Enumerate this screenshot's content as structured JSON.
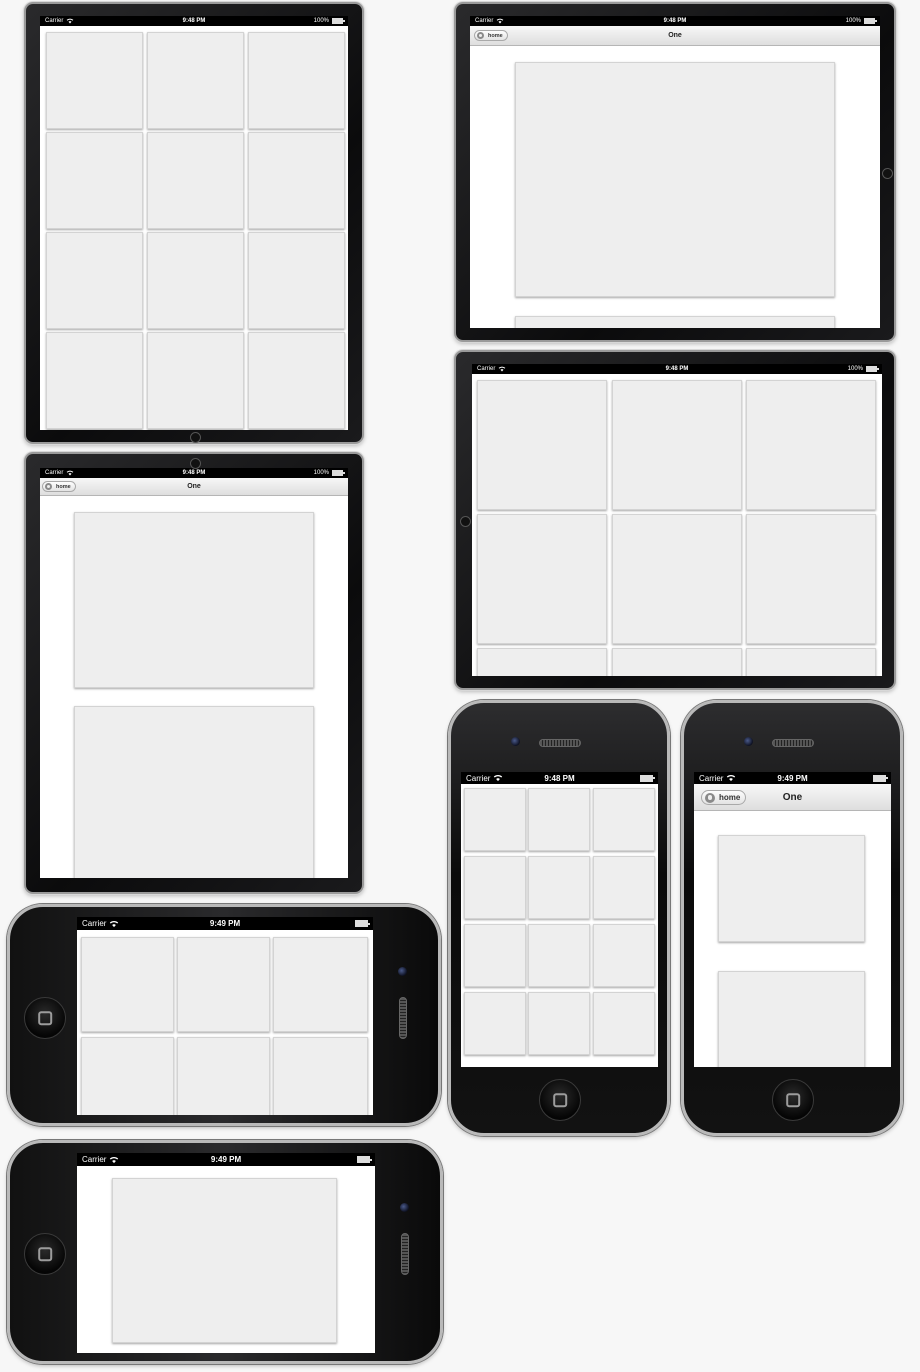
{
  "status": {
    "carrier": "Carrier",
    "battery": "100%",
    "time_948": "9:48 PM",
    "time_949": "9:49 PM"
  },
  "nav": {
    "back_label": "home",
    "title": "One"
  },
  "colors": {
    "device_body": "#0b0b0c",
    "screen_bg": "#ffffff",
    "tile_bg": "#eeeeee",
    "tile_border": "#d3d3d3",
    "navbar_top": "#f7f7f7",
    "navbar_bottom": "#dedede"
  },
  "icons": [
    "wifi-icon",
    "battery-icon",
    "home-icon",
    "home-button-icon"
  ]
}
